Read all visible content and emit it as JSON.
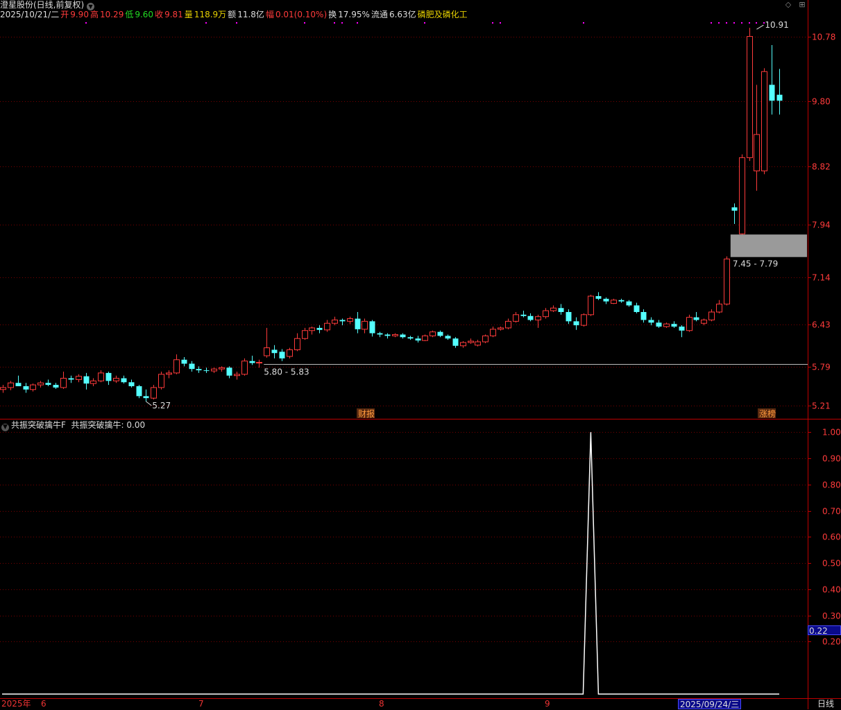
{
  "header": {
    "stock_title": "澄星股份(日线,前复权)",
    "date": "2025/10/21/二",
    "open_label": "开",
    "open": "9.90",
    "high_label": "高",
    "high": "10.29",
    "low_label": "低",
    "low": "9.60",
    "close_label": "收",
    "close": "9.81",
    "volume_label": "量",
    "volume": "118.9万",
    "amount_label": "额",
    "amount": "11.8亿",
    "change_label": "幅",
    "change": "0.01(0.10%)",
    "turnover_label": "换",
    "turnover": "17.95%",
    "float_label": "流通",
    "float_cap": "6.63亿",
    "industry": "磷肥及磷化工"
  },
  "colors": {
    "up": "#ff3b3b",
    "down": "#54ffff",
    "grid": "#7a0000",
    "axis": "#c00000",
    "magenta": "#ff00ff",
    "zone": "#9a9a9a",
    "indicator_line": "#ffffff"
  },
  "price_axis": {
    "ticks": [
      "10.78",
      "9.80",
      "8.82",
      "7.94",
      "7.14",
      "6.43",
      "5.79",
      "5.21"
    ]
  },
  "annotations": {
    "high_marker": "10.91",
    "low_marker": "5.27",
    "support_range": "5.80 - 5.83",
    "zone_range": "7.45 - 7.79",
    "event_earnings": "财报",
    "event_limitup": "涨榜"
  },
  "indicator": {
    "name": "共振突破擒牛F",
    "value_label": "共振突破擒牛: 0.00",
    "ticks": [
      "1.00",
      "0.90",
      "0.80",
      "0.70",
      "0.60",
      "0.50",
      "0.40",
      "0.30",
      "0.20"
    ],
    "current_value": "0.22"
  },
  "x_axis": {
    "labels": [
      "2025年",
      "6",
      "7",
      "8",
      "9"
    ],
    "selected_date": "2025/09/24/三",
    "period": "日线"
  },
  "chart_data": [
    {
      "type": "candlestick",
      "title": "澄星股份(日线,前复权)",
      "ylim": [
        5.05,
        11.1
      ],
      "y_ticks": [
        10.78,
        9.8,
        8.82,
        7.94,
        7.14,
        6.43,
        5.79,
        5.21
      ],
      "ohlc": [
        [
          5.45,
          5.52,
          5.4,
          5.48
        ],
        [
          5.48,
          5.58,
          5.44,
          5.55
        ],
        [
          5.55,
          5.66,
          5.5,
          5.5
        ],
        [
          5.5,
          5.55,
          5.4,
          5.45
        ],
        [
          5.45,
          5.54,
          5.42,
          5.52
        ],
        [
          5.52,
          5.58,
          5.48,
          5.55
        ],
        [
          5.55,
          5.6,
          5.5,
          5.52
        ],
        [
          5.52,
          5.55,
          5.46,
          5.48
        ],
        [
          5.48,
          5.72,
          5.46,
          5.62
        ],
        [
          5.62,
          5.66,
          5.55,
          5.6
        ],
        [
          5.6,
          5.68,
          5.56,
          5.65
        ],
        [
          5.65,
          5.7,
          5.45,
          5.54
        ],
        [
          5.54,
          5.62,
          5.5,
          5.58
        ],
        [
          5.58,
          5.74,
          5.56,
          5.7
        ],
        [
          5.7,
          5.72,
          5.52,
          5.58
        ],
        [
          5.58,
          5.66,
          5.55,
          5.62
        ],
        [
          5.62,
          5.66,
          5.54,
          5.56
        ],
        [
          5.56,
          5.6,
          5.48,
          5.5
        ],
        [
          5.5,
          5.52,
          5.32,
          5.35
        ],
        [
          5.35,
          5.45,
          5.27,
          5.32
        ],
        [
          5.32,
          5.52,
          5.3,
          5.48
        ],
        [
          5.48,
          5.72,
          5.45,
          5.68
        ],
        [
          5.68,
          5.74,
          5.62,
          5.7
        ],
        [
          5.7,
          5.98,
          5.68,
          5.9
        ],
        [
          5.9,
          5.94,
          5.8,
          5.84
        ],
        [
          5.84,
          5.88,
          5.72,
          5.76
        ],
        [
          5.76,
          5.8,
          5.7,
          5.74
        ],
        [
          5.74,
          5.78,
          5.7,
          5.73
        ],
        [
          5.73,
          5.78,
          5.7,
          5.76
        ],
        [
          5.76,
          5.8,
          5.72,
          5.78
        ],
        [
          5.78,
          5.8,
          5.62,
          5.66
        ],
        [
          5.66,
          5.72,
          5.6,
          5.68
        ],
        [
          5.68,
          5.92,
          5.66,
          5.88
        ],
        [
          5.88,
          5.96,
          5.82,
          5.85
        ],
        [
          5.85,
          5.9,
          5.78,
          5.86
        ],
        [
          5.96,
          6.38,
          5.93,
          6.08
        ],
        [
          6.05,
          6.12,
          5.92,
          6.0
        ],
        [
          6.02,
          6.06,
          5.88,
          5.92
        ],
        [
          5.95,
          6.08,
          5.92,
          6.05
        ],
        [
          6.05,
          6.3,
          6.03,
          6.22
        ],
        [
          6.22,
          6.38,
          6.2,
          6.34
        ],
        [
          6.34,
          6.4,
          6.28,
          6.38
        ],
        [
          6.38,
          6.42,
          6.3,
          6.35
        ],
        [
          6.35,
          6.5,
          6.32,
          6.45
        ],
        [
          6.45,
          6.55,
          6.42,
          6.5
        ],
        [
          6.5,
          6.52,
          6.42,
          6.48
        ],
        [
          6.48,
          6.55,
          6.44,
          6.52
        ],
        [
          6.52,
          6.62,
          6.3,
          6.36
        ],
        [
          6.36,
          6.52,
          6.3,
          6.48
        ],
        [
          6.48,
          6.5,
          6.25,
          6.3
        ],
        [
          6.3,
          6.32,
          6.24,
          6.28
        ],
        [
          6.28,
          6.3,
          6.22,
          6.26
        ],
        [
          6.26,
          6.3,
          6.24,
          6.28
        ],
        [
          6.28,
          6.3,
          6.22,
          6.24
        ],
        [
          6.24,
          6.26,
          6.2,
          6.22
        ],
        [
          6.22,
          6.26,
          6.16,
          6.19
        ],
        [
          6.19,
          6.28,
          6.18,
          6.26
        ],
        [
          6.26,
          6.34,
          6.24,
          6.32
        ],
        [
          6.32,
          6.34,
          6.24,
          6.26
        ],
        [
          6.26,
          6.28,
          6.2,
          6.22
        ],
        [
          6.22,
          6.24,
          6.08,
          6.11
        ],
        [
          6.11,
          6.18,
          6.08,
          6.16
        ],
        [
          6.16,
          6.22,
          6.14,
          6.18
        ],
        [
          6.12,
          6.2,
          6.1,
          6.17
        ],
        [
          6.17,
          6.28,
          6.15,
          6.26
        ],
        [
          6.26,
          6.4,
          6.24,
          6.36
        ],
        [
          6.36,
          6.4,
          6.34,
          6.38
        ],
        [
          6.38,
          6.52,
          6.36,
          6.48
        ],
        [
          6.48,
          6.62,
          6.46,
          6.58
        ],
        [
          6.58,
          6.64,
          6.54,
          6.56
        ],
        [
          6.56,
          6.6,
          6.48,
          6.5
        ],
        [
          6.5,
          6.58,
          6.38,
          6.55
        ],
        [
          6.55,
          6.68,
          6.52,
          6.64
        ],
        [
          6.64,
          6.72,
          6.62,
          6.68
        ],
        [
          6.68,
          6.74,
          6.58,
          6.62
        ],
        [
          6.62,
          6.66,
          6.44,
          6.48
        ],
        [
          6.48,
          6.54,
          6.35,
          6.42
        ],
        [
          6.42,
          6.6,
          6.4,
          6.58
        ],
        [
          6.58,
          6.88,
          6.56,
          6.86
        ],
        [
          6.86,
          6.92,
          6.8,
          6.82
        ],
        [
          6.82,
          6.84,
          6.74,
          6.78
        ],
        [
          6.75,
          6.82,
          6.74,
          6.8
        ],
        [
          6.8,
          6.82,
          6.76,
          6.78
        ],
        [
          6.78,
          6.8,
          6.7,
          6.72
        ],
        [
          6.72,
          6.76,
          6.6,
          6.62
        ],
        [
          6.62,
          6.66,
          6.46,
          6.5
        ],
        [
          6.5,
          6.54,
          6.42,
          6.46
        ],
        [
          6.46,
          6.5,
          6.38,
          6.4
        ],
        [
          6.4,
          6.46,
          6.38,
          6.44
        ],
        [
          6.44,
          6.48,
          6.38,
          6.4
        ],
        [
          6.4,
          6.42,
          6.24,
          6.34
        ],
        [
          6.34,
          6.58,
          6.32,
          6.54
        ],
        [
          6.54,
          6.62,
          6.48,
          6.5
        ],
        [
          6.45,
          6.52,
          6.42,
          6.5
        ],
        [
          6.5,
          6.66,
          6.48,
          6.62
        ],
        [
          6.62,
          6.8,
          6.6,
          6.74
        ],
        [
          6.74,
          7.46,
          6.72,
          7.42
        ],
        [
          8.2,
          8.26,
          7.95,
          8.15
        ],
        [
          7.8,
          9.0,
          7.78,
          8.95
        ],
        [
          8.95,
          10.91,
          8.9,
          10.78
        ],
        [
          8.75,
          10.05,
          8.45,
          9.3
        ],
        [
          8.75,
          10.3,
          8.7,
          10.25
        ],
        [
          10.05,
          10.65,
          9.6,
          9.81
        ],
        [
          9.9,
          10.29,
          9.6,
          9.81
        ]
      ],
      "annotations": {
        "high": 10.91,
        "low": 5.27,
        "support": [
          5.8,
          5.83
        ],
        "zone": [
          7.45,
          7.79
        ]
      }
    },
    {
      "type": "line",
      "title": "共振突破擒牛F",
      "ylim": [
        0.0,
        1.03
      ],
      "y_ticks": [
        1.0,
        0.9,
        0.8,
        0.7,
        0.6,
        0.5,
        0.4,
        0.3,
        0.2
      ],
      "series": [
        {
          "name": "共振突破擒牛",
          "spike_index": 78,
          "spike_value": 1.0,
          "baseline": 0.0
        }
      ]
    }
  ]
}
